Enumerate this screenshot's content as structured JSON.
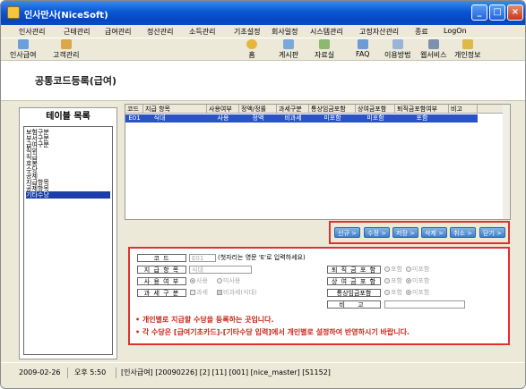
{
  "window": {
    "title": "인사만사(NiceSoft)",
    "minimize": "_",
    "maximize": "□",
    "close": "×"
  },
  "menu": [
    "인사관리",
    "근태관리",
    "급여관리",
    "정산관리",
    "소득관리",
    "기초설정",
    "회사일정",
    "시스템관리",
    "고정자산관리",
    "종료",
    "LogOn"
  ],
  "toolbar": {
    "left": [
      {
        "label": "인사급여",
        "icon": "payroll-icon"
      },
      {
        "label": "고객관리",
        "icon": "customer-icon"
      }
    ],
    "right": [
      {
        "label": "홈",
        "icon": "home-icon"
      },
      {
        "label": "게시판",
        "icon": "board-icon"
      },
      {
        "label": "자료실",
        "icon": "archive-icon"
      },
      {
        "label": "FAQ",
        "icon": "faq-icon"
      },
      {
        "label": "이용방법",
        "icon": "guide-icon"
      },
      {
        "label": "웹서비스",
        "icon": "web-icon"
      },
      {
        "label": "개인정보",
        "icon": "key-icon"
      }
    ]
  },
  "page": {
    "title": "공통코드등록(급여)"
  },
  "left_panel": {
    "title": "테이블 목록",
    "items": [
      "보험구분",
      "부서구분",
      "급여구분",
      "직위",
      "직급",
      "호봉",
      "수당",
      "공제",
      "지급항목",
      "공제항목",
      "기타수당"
    ],
    "selected_index": 10
  },
  "grid": {
    "columns": [
      "코드",
      "지급 항목",
      "사용여부",
      "정액/정률",
      "과세구분",
      "통상임금포함",
      "상여금포함",
      "퇴직금포함여부",
      "비고"
    ],
    "rows": [
      [
        "E01",
        "식대",
        "사용",
        "정액",
        "비과세",
        "미포함",
        "미포함",
        "포함",
        ""
      ]
    ]
  },
  "buttons": [
    "신규 >",
    "수정 >",
    "저장 >",
    "삭제 >",
    "취소 >",
    "닫기 >"
  ],
  "form": {
    "code_label": "코 드",
    "code_value": "E01",
    "code_hint": "(첫자리는 영문 'E'로 입력하세요)",
    "item_label": "지 급 항 목",
    "item_value": "식대",
    "use_label": "사 용 여 부",
    "use_options": [
      "사용",
      "미사용"
    ],
    "tax_label": "과 세 구 분",
    "tax_options": [
      "과세",
      "비과세(식대)"
    ],
    "retire_label": "퇴 직 금 포 함",
    "retire_options": [
      "포함",
      "미포함"
    ],
    "bonus_label": "상 여 금 포 함",
    "bonus_options": [
      "포함",
      "미포함"
    ],
    "ordinary_label": "통상임금포함",
    "ordinary_options": [
      "포함",
      "미포함"
    ],
    "memo_label": "비 고",
    "notes": [
      "• 개인별로 지급할 수당을 등록하는 곳입니다.",
      "• 각 수당은 [급여기초카드]-[기타수당 입력]에서 개인별로 설정하여 반영하시기 바랍니다."
    ]
  },
  "status": {
    "date": "2009-02-26",
    "time": "오후 5:50",
    "info": "[인사급여] [20090226] [2] [11] [001] [nice_master] [S1152]"
  },
  "colors": {
    "title_bar": "#0a57d6",
    "highlight": "#e03030",
    "selection": "#1c3ea8",
    "note_text": "#c8291b"
  }
}
